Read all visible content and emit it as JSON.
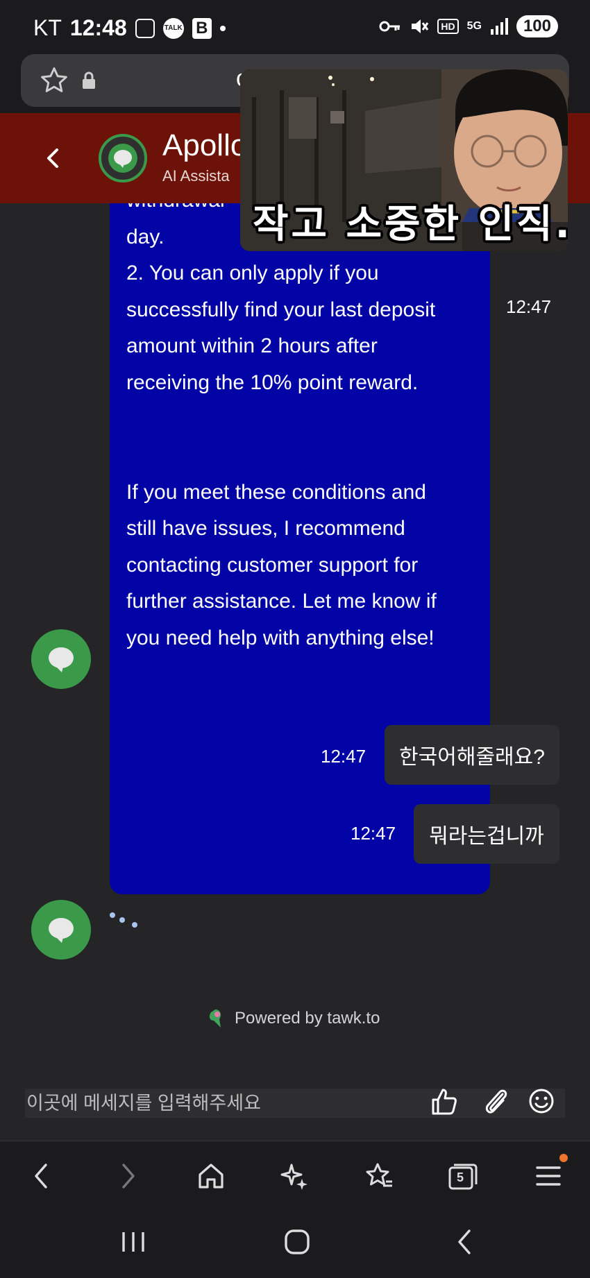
{
  "status_bar": {
    "carrier": "KT",
    "time": "12:48",
    "talk_badge": "TALK",
    "b_badge": "B",
    "network": "5G",
    "hd_label": "HD",
    "battery": "100"
  },
  "browser": {
    "url_text": "c"
  },
  "chat_header": {
    "agent_name": "Apollo",
    "agent_role": "AI Assista"
  },
  "video_overlay": {
    "caption": "작고 소중한 인직.."
  },
  "messages": {
    "agent_message": {
      "lines": [
        "withdrawal",
        "day.",
        "2. You can only apply if you",
        "successfully find your last deposit",
        "amount within 2 hours after",
        "receiving the 10% point reward.",
        "If you meet these conditions and",
        "still have issues, I recommend",
        "contacting customer support for",
        "further assistance. Let me know if",
        "you need help with anything else!"
      ],
      "time": "12:47"
    },
    "user_message_1": {
      "text": "한국어해줄래요?",
      "time": "12:47"
    },
    "user_message_2": {
      "text": "뭐라는겁니까",
      "time": "12:47"
    }
  },
  "footer": {
    "powered_by": "Powered by tawk.to"
  },
  "composer": {
    "placeholder": "이곳에 메세지를 입력해주세요"
  },
  "browser_nav": {
    "tabs_count": "5"
  },
  "colors": {
    "header_bg": "#6d1208",
    "agent_bubble_bg": "#0304a6",
    "avatar_green": "#3a9a4a",
    "chat_bg": "#252527",
    "notification_dot": "#f0742d"
  }
}
